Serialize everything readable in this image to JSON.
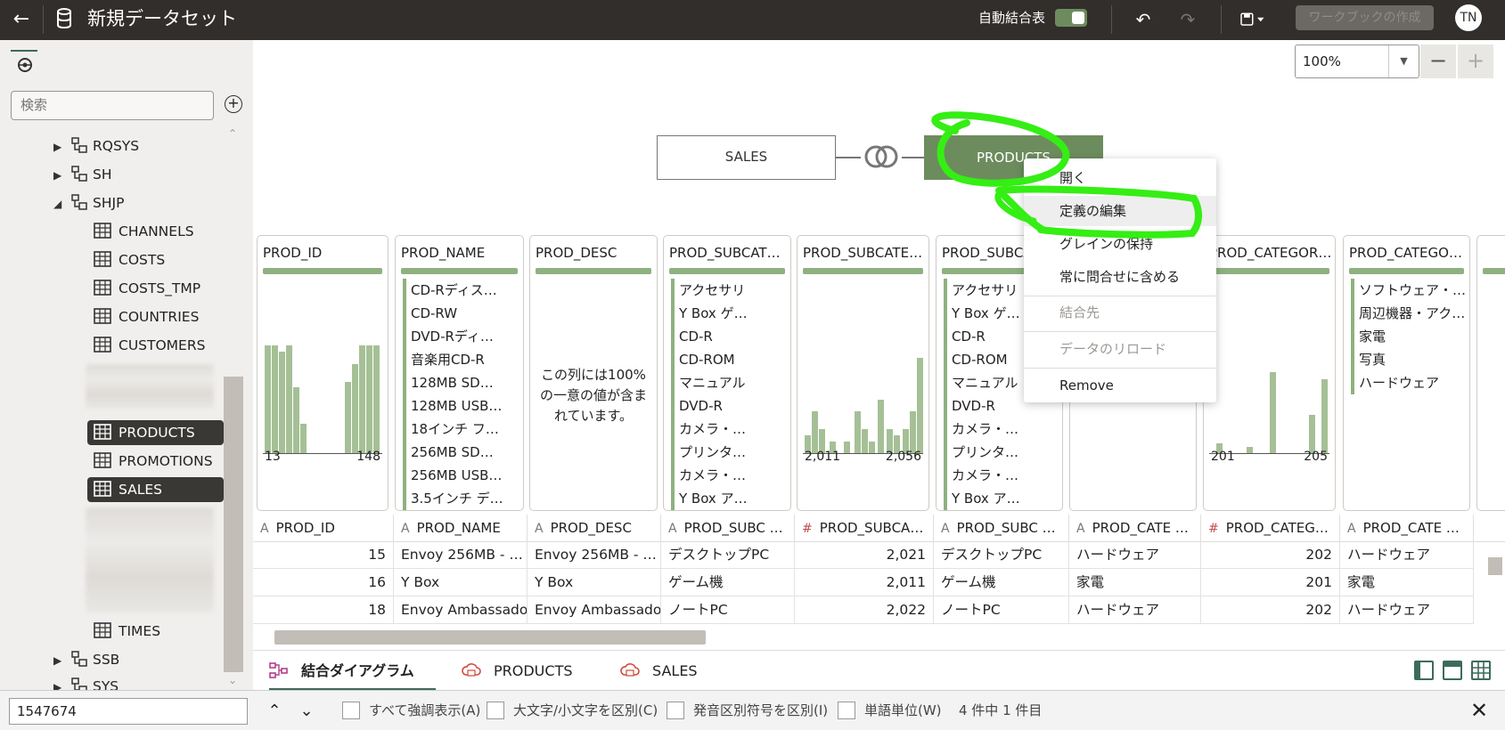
{
  "topbar": {
    "back_icon": "arrow-left-icon",
    "title": "新規データセット",
    "auto_join_label": "自動結合表",
    "auto_join_on": true,
    "create_workbook_label": "ワークブックの作成",
    "user_initials": "TN"
  },
  "sidebar": {
    "search_placeholder": "検索",
    "tree": [
      {
        "label": "RQSYS",
        "type": "schema",
        "expanded": false
      },
      {
        "label": "SH",
        "type": "schema",
        "expanded": false
      },
      {
        "label": "SHJP",
        "type": "schema",
        "expanded": true
      },
      {
        "label": "CHANNELS",
        "type": "table"
      },
      {
        "label": "COSTS",
        "type": "table"
      },
      {
        "label": "COSTS_TMP",
        "type": "table"
      },
      {
        "label": "COUNTRIES",
        "type": "table"
      },
      {
        "label": "CUSTOMERS",
        "type": "table"
      },
      {
        "label": "PRODUCTS",
        "type": "table",
        "selected": true
      },
      {
        "label": "PROMOTIONS",
        "type": "table"
      },
      {
        "label": "SALES",
        "type": "table",
        "selected": true
      },
      {
        "label": "TIMES",
        "type": "table"
      },
      {
        "label": "SSB",
        "type": "schema",
        "expanded": false
      },
      {
        "label": "SYS",
        "type": "schema",
        "expanded": false
      }
    ]
  },
  "canvas": {
    "zoom": "100%",
    "nodes": {
      "left": "SALES",
      "right": "PRODUCTS"
    }
  },
  "context_menu": {
    "items": [
      {
        "label": "開く",
        "enabled": true
      },
      {
        "label": "定義の編集",
        "enabled": true,
        "hovered": true
      },
      {
        "label": "グレインの保持",
        "enabled": true
      },
      {
        "label": "常に問合せに含める",
        "enabled": true
      },
      {
        "label": "結合先",
        "enabled": false
      },
      {
        "label": "データのリロード",
        "enabled": false
      },
      {
        "label": "Remove",
        "enabled": true
      }
    ]
  },
  "profiles": [
    {
      "title": "PROD_ID",
      "kind": "hist",
      "min": "13",
      "max": "148"
    },
    {
      "title": "PROD_NAME",
      "kind": "list",
      "values": [
        "CD-Rディス…",
        "CD-RW",
        "DVD-Rディ…",
        "音楽用CD-R",
        "128MB SD…",
        "128MB USB…",
        "18インチ フ…",
        "256MB SD…",
        "256MB USB…",
        "3.5インチ デ…"
      ]
    },
    {
      "title": "PROD_DESC",
      "kind": "unique",
      "text": "この列には100%の一意の値が含まれています。"
    },
    {
      "title": "PROD_SUBCAT…",
      "kind": "list",
      "values": [
        "アクセサリ",
        "Y Box ゲ…",
        "CD-R",
        "CD-ROM",
        "マニュアル",
        "DVD-R",
        "カメラ・…",
        "プリンタ…",
        "カメラ・…",
        "Y Box ア…"
      ]
    },
    {
      "title": "PROD_SUBCATE…",
      "kind": "hist",
      "min": "2,011",
      "max": "2,056"
    },
    {
      "title": "PROD_SUBCA…",
      "kind": "list",
      "values": [
        "アクセサリ",
        "Y Box ゲ…",
        "CD-R",
        "CD-ROM",
        "マニュアル",
        "DVD-R",
        "カメラ・…",
        "プリンタ…",
        "カメラ・…",
        "Y Box ア…"
      ]
    },
    {
      "title": "",
      "kind": "blank"
    },
    {
      "title": "PROD_CATEGOR…",
      "kind": "hist",
      "min": "201",
      "max": "205"
    },
    {
      "title": "PROD_CATEGO…",
      "kind": "list",
      "values": [
        "ソフトウェア・…",
        "周辺機器・アク…",
        "家電",
        "写真",
        "ハードウェア"
      ]
    }
  ],
  "columns": [
    {
      "type": "A",
      "name": "PROD_ID"
    },
    {
      "type": "A",
      "name": "PROD_NAME"
    },
    {
      "type": "A",
      "name": "PROD_DESC"
    },
    {
      "type": "A",
      "name": "PROD_SUBC …"
    },
    {
      "type": "#",
      "name": "PROD_SUBCA…"
    },
    {
      "type": "A",
      "name": "PROD_SUBC …"
    },
    {
      "type": "A",
      "name": "PROD_CATE …"
    },
    {
      "type": "#",
      "name": "PROD_CATEG…"
    },
    {
      "type": "A",
      "name": "PROD_CATE …"
    }
  ],
  "rows": [
    [
      "15",
      "Envoy 256MB - …",
      "Envoy 256MB - …",
      "デスクトップPC",
      "2,021",
      "デスクトップPC",
      "ハードウェア",
      "202",
      "ハードウェア"
    ],
    [
      "16",
      "Y Box",
      "Y Box",
      "ゲーム機",
      "2,011",
      "ゲーム機",
      "家電",
      "201",
      "家電"
    ],
    [
      "18",
      "Envoy Ambassador",
      "Envoy Ambassador",
      "ノートPC",
      "2,022",
      "ノートPC",
      "ハードウェア",
      "202",
      "ハードウェア"
    ]
  ],
  "tabs": [
    {
      "label": "結合ダイアグラム",
      "active": true
    },
    {
      "label": "PRODUCTS",
      "active": false
    },
    {
      "label": "SALES",
      "active": false
    }
  ],
  "findbar": {
    "value": "1547674",
    "options": [
      "すべて強調表示(A)",
      "大文字/小文字を区別(C)",
      "発音区別符号を区別(I)",
      "単語単位(W)"
    ],
    "count": "4 件中 1 件目"
  }
}
